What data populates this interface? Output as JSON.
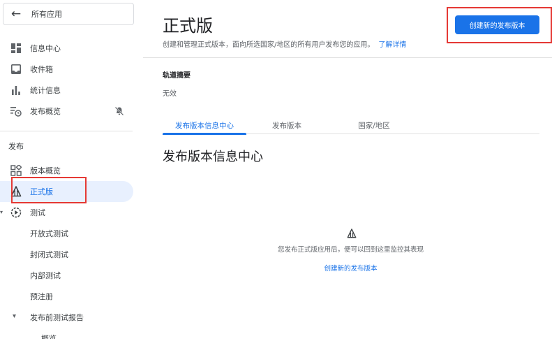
{
  "sidebar": {
    "back_label": "所有应用",
    "top_items": [
      {
        "label": "信息中心",
        "icon": "dashboard-icon"
      },
      {
        "label": "收件箱",
        "icon": "inbox-icon"
      },
      {
        "label": "统计信息",
        "icon": "bar-chart-icon"
      },
      {
        "label": "发布概览",
        "icon": "schedule-list-icon",
        "badge_icon": "notifications-off-icon"
      }
    ],
    "section_title": "发布",
    "release_items": [
      {
        "label": "版本概览",
        "icon": "widgets-icon"
      },
      {
        "label": "正式版",
        "icon": "production-icon",
        "active": true
      },
      {
        "label": "测试",
        "icon": "play-circle-icon"
      },
      {
        "label": "开放式测试"
      },
      {
        "label": "封闭式测试"
      },
      {
        "label": "内部测试"
      },
      {
        "label": "预注册"
      },
      {
        "label": "发布前测试报告",
        "icon": "caret-down-icon"
      },
      {
        "label": "概览"
      }
    ]
  },
  "header": {
    "title": "正式版",
    "description": "创建和管理正式版本，面向所选国家/地区的所有用户发布您的应用。",
    "learn_more": "了解详情",
    "create_button": "创建新的发布版本"
  },
  "track_summary": {
    "label": "轨道摘要",
    "value": "无效"
  },
  "tabs": [
    {
      "label": "发布版本信息中心",
      "active": true
    },
    {
      "label": "发布版本",
      "active": false
    },
    {
      "label": "国家/地区",
      "active": false
    }
  ],
  "section_heading": "发布版本信息中心",
  "empty_state": {
    "icon": "production-icon",
    "message": "您发布正式版应用后，便可以回到这里监控其表现",
    "link": "创建新的发布版本"
  },
  "colors": {
    "accent": "#1a73e8",
    "highlight_box": "#e53935",
    "active_bg": "#e8f0fe"
  }
}
